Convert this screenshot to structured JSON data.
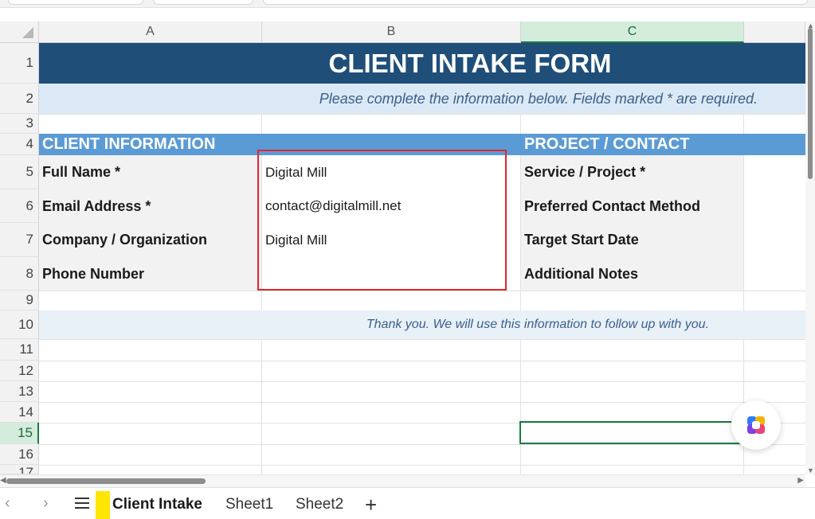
{
  "columns": [
    {
      "letter": "A",
      "selected": false
    },
    {
      "letter": "B",
      "selected": false
    },
    {
      "letter": "C",
      "selected": true
    }
  ],
  "rows": [
    "1",
    "2",
    "3",
    "4",
    "5",
    "6",
    "7",
    "8",
    "9",
    "10",
    "11",
    "12",
    "13",
    "14",
    "15",
    "16",
    "17"
  ],
  "selected_row": "15",
  "form": {
    "title": "CLIENT INTAKE FORM",
    "subtitle": "Please complete the information below. Fields marked * are required.",
    "client_section": "CLIENT INFORMATION",
    "project_section": "PROJECT / CONTACT",
    "client_fields": [
      {
        "label": "Full Name *",
        "value": "Digital Mill"
      },
      {
        "label": "Email Address *",
        "value": "contact@digitalmill.net"
      },
      {
        "label": "Company / Organization",
        "value": "Digital Mill"
      },
      {
        "label": "Phone Number",
        "value": ""
      }
    ],
    "project_fields": [
      {
        "label": "Service / Project *"
      },
      {
        "label": "Preferred Contact Method"
      },
      {
        "label": "Target Start Date"
      },
      {
        "label": "Additional Notes"
      }
    ],
    "thanks": "Thank you. We will use this information to follow up with you."
  },
  "tabs": {
    "active": "Client Intake",
    "others": [
      "Sheet1",
      "Sheet2"
    ],
    "add": "+"
  },
  "nav": {
    "prev": "‹",
    "next": "›"
  },
  "icons": {
    "corner": "select-all-icon",
    "copilot": "copilot-icon",
    "menu": "sheet-list-icon"
  },
  "colors": {
    "title_band": "#1f4e79",
    "section_band": "#5b9bd5",
    "subtitle_band": "#dbe9f6",
    "highlight_border": "#e0262e",
    "active_cell_border": "#1e7b45",
    "tab_marker": "#ffe600"
  }
}
